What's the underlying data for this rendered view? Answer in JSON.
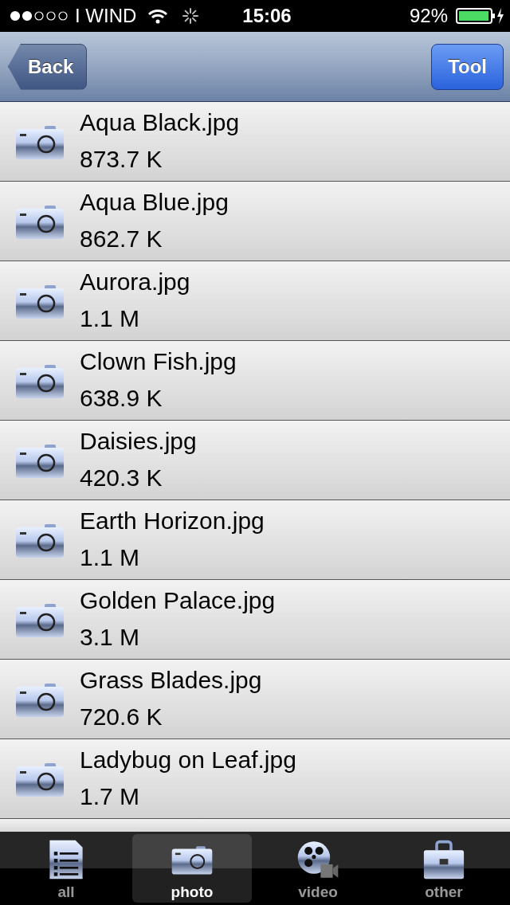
{
  "status_bar": {
    "carrier": "I WIND",
    "time": "15:06",
    "battery": "92%"
  },
  "nav_bar": {
    "back": "Back",
    "action": "Tool"
  },
  "files": [
    {
      "name": "Aqua Black.jpg",
      "size": "873.7 K"
    },
    {
      "name": "Aqua Blue.jpg",
      "size": "862.7 K"
    },
    {
      "name": "Aurora.jpg",
      "size": "1.1 M"
    },
    {
      "name": "Clown Fish.jpg",
      "size": "638.9 K"
    },
    {
      "name": "Daisies.jpg",
      "size": "420.3 K"
    },
    {
      "name": "Earth  Horizon.jpg",
      "size": "1.1 M"
    },
    {
      "name": "Golden Palace.jpg",
      "size": "3.1 M"
    },
    {
      "name": "Grass Blades.jpg",
      "size": "720.6 K"
    },
    {
      "name": "Ladybug on Leaf.jpg",
      "size": "1.7 M"
    }
  ],
  "tabs": [
    {
      "label": "all",
      "kind": "list",
      "selected": false
    },
    {
      "label": "photo",
      "kind": "camera",
      "selected": true
    },
    {
      "label": "video",
      "kind": "film",
      "selected": false
    },
    {
      "label": "other",
      "kind": "toolbox",
      "selected": false
    }
  ]
}
